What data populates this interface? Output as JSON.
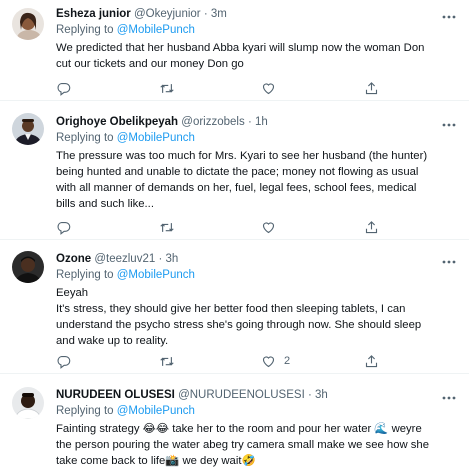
{
  "tweets": [
    {
      "name": "Esheza junior",
      "handle": "@Okeyjunior",
      "sep": "·",
      "time": "3m",
      "replying_prefix": "Replying to ",
      "replying_to": "@MobilePunch",
      "lines": [
        "We predicted that her husband Abba kyari will slump now the woman Don",
        "cut our tickets and our money Don go"
      ],
      "reply_count": "",
      "retweet_count": "",
      "like_count": ""
    },
    {
      "name": "Orighoye Obelikpeyah",
      "handle": "@orizzobels",
      "sep": "·",
      "time": "1h",
      "replying_prefix": "Replying to ",
      "replying_to": "@MobilePunch",
      "lines": [
        "The pressure was too much for Mrs. Kyari to see her husband (the hunter)",
        "being hunted and unable to dictate the pace; money not flowing as usual",
        "with all manner of demands on her, fuel, legal fees, school fees, medical",
        "bills and such like..."
      ],
      "reply_count": "",
      "retweet_count": "",
      "like_count": ""
    },
    {
      "name": "Ozone",
      "handle": "@teezluv21",
      "sep": "·",
      "time": "3h",
      "replying_prefix": "Replying to ",
      "replying_to": "@MobilePunch",
      "lines": [
        "Eeyah",
        "It's stress, they should give her better food then sleeping tablets, I can",
        "understand the psycho stress she's going through now. She should sleep",
        "and wake up to reality."
      ],
      "reply_count": "",
      "retweet_count": "",
      "like_count": "2"
    },
    {
      "name": "NURUDEEN OLUSESI",
      "handle": "@NURUDEENOLUSESI",
      "sep": "·",
      "time": "3h",
      "replying_prefix": "Replying to ",
      "replying_to": "@MobilePunch",
      "lines": [
        "Fainting strategy 😂😂 take her to the room and pour her water 🌊 weyre",
        "the person pouring the water abeg try camera small make we see how she",
        "take come back to life📸 we dey wait🤣"
      ],
      "reply_count": "",
      "retweet_count": "",
      "like_count": ""
    }
  ],
  "icons": {
    "more": "more-horizontal-icon",
    "reply": "reply-icon",
    "retweet": "retweet-icon",
    "like": "like-icon",
    "share": "share-icon"
  },
  "colors": {
    "link": "#1d9bf0",
    "secondary_text": "#536471",
    "primary_text": "#0f1419",
    "divider": "#eff3f4"
  }
}
